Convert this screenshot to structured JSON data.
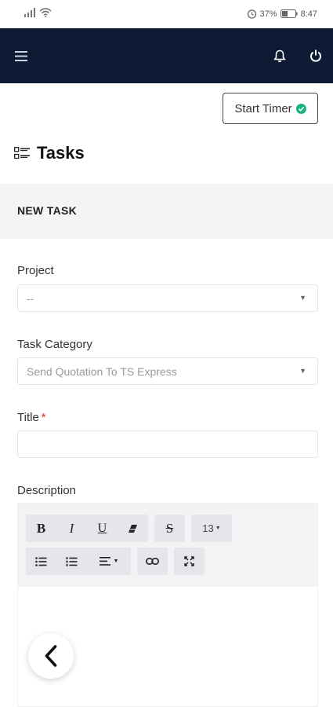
{
  "status_bar": {
    "battery_text": "37%",
    "time": "8:47"
  },
  "header": {
    "menu_icon": "hamburger-icon",
    "notification_icon": "bell-icon",
    "power_icon": "power-icon",
    "background_color": "#0d1a33"
  },
  "timer": {
    "label": "Start Timer",
    "icon": "check-circle-icon",
    "icon_color": "#19b47a"
  },
  "page": {
    "title": "Tasks",
    "title_icon": "task-list-icon"
  },
  "section": {
    "title": "NEW TASK"
  },
  "form": {
    "project": {
      "label": "Project",
      "value": "--"
    },
    "task_category": {
      "label": "Task Category",
      "value": "Send Quotation To TS Express"
    },
    "title": {
      "label": "Title",
      "required_mark": "*",
      "value": ""
    },
    "description": {
      "label": "Description",
      "toolbar": {
        "bold": "B",
        "italic": "I",
        "underline": "U",
        "strikethrough": "S",
        "font_size": "13",
        "eraser_icon": "eraser-icon",
        "bullet_list_icon": "bullet-list-icon",
        "numbered_list_icon": "numbered-list-icon",
        "align_icon": "align-left-icon",
        "link_icon": "link-icon",
        "fullscreen_icon": "fullscreen-icon"
      }
    }
  },
  "back_button": {
    "icon": "chevron-left-icon"
  }
}
